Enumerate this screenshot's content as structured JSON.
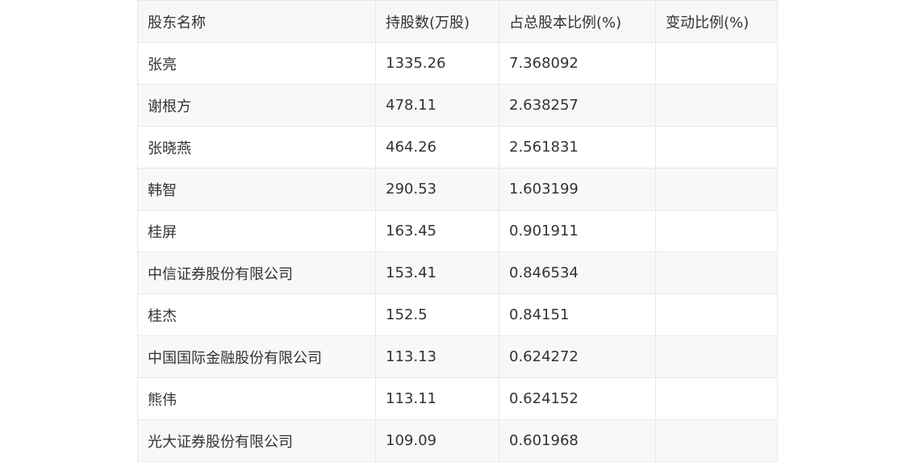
{
  "table": {
    "headers": [
      "股东名称",
      "持股数(万股)",
      "占总股本比例(%)",
      "变动比例(%)"
    ],
    "rows": [
      [
        "张亮",
        "1335.26",
        "7.368092",
        ""
      ],
      [
        "谢根方",
        "478.11",
        "2.638257",
        ""
      ],
      [
        "张晓燕",
        "464.26",
        "2.561831",
        ""
      ],
      [
        "韩智",
        "290.53",
        "1.603199",
        ""
      ],
      [
        "桂屏",
        "163.45",
        "0.901911",
        ""
      ],
      [
        "中信证券股份有限公司",
        "153.41",
        "0.846534",
        ""
      ],
      [
        "桂杰",
        "152.5",
        "0.84151",
        ""
      ],
      [
        "中国国际金融股份有限公司",
        "113.13",
        "0.624272",
        ""
      ],
      [
        "熊伟",
        "113.11",
        "0.624152",
        ""
      ],
      [
        "光大证券股份有限公司",
        "109.09",
        "0.601968",
        ""
      ]
    ]
  }
}
